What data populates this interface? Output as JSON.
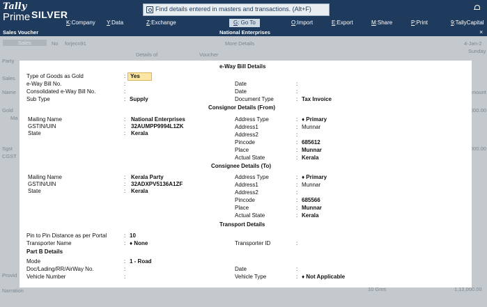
{
  "app": {
    "logo_top": "Tally",
    "logo_bottom": "Prime",
    "edition": "SILVER"
  },
  "search": {
    "placeholder": "Find details entered in masters and transactions. (Alt+F)"
  },
  "menu": [
    {
      "key": "K",
      "label": ":Company"
    },
    {
      "key": "Y",
      "label": ":Data"
    },
    {
      "key": "Z",
      "label": ":Exchange"
    },
    {
      "key": "G",
      "label": ": Go To"
    },
    {
      "key": "O",
      "label": ":Import"
    },
    {
      "key": "E",
      "label": ":Export"
    },
    {
      "key": "M",
      "label": ":Share"
    },
    {
      "key": "P",
      "label": ":Print"
    },
    {
      "key": "9",
      "label": ":TallyCapital"
    }
  ],
  "voucher_bar": {
    "title": "Sales Voucher",
    "company": "National Enterprises",
    "close": "×"
  },
  "background": {
    "type_tag": "Sales",
    "no_label": "No",
    "voucher_no": "forjecn91",
    "more_details": "More Details",
    "date": "4-Jan-2",
    "day": "Sunday",
    "party_label": "Party",
    "sales_label": "Sales",
    "name_label": "Name",
    "amount_label": "Amount",
    "item1": "Gold",
    "item1_sub": "Ma",
    "item1_amt": "000.00",
    "item2": "Sgst",
    "item2_sub": "CGST",
    "item2_amt": "000.00",
    "provided_label": "Provid",
    "narration_label": "Narration",
    "total_qty": "10 Gms",
    "total_amt": "1,12,000.00",
    "col_details_of": "Details of",
    "col_voucher": "Voucher"
  },
  "modal": {
    "title": "e-Way Bill Details",
    "type_of_goods": {
      "label": "Type of Goods as Gold",
      "value": "Yes"
    },
    "eway_bill_no": {
      "label": "e-Way Bill No.",
      "value": "",
      "date_label": "Date",
      "date_value": ""
    },
    "consolidated": {
      "label": "Consolidated e-Way Bill No.",
      "value": "",
      "date_label": "Date",
      "date_value": ""
    },
    "sub_type": {
      "label": "Sub Type",
      "value": "Supply",
      "doc_label": "Document Type",
      "doc_value": "Tax Invoice"
    },
    "consignor": {
      "heading": "Consignor Details (From)",
      "mailing_name": {
        "label": "Mailing Name",
        "value": "National Enterprises"
      },
      "gstin": {
        "label": "GSTIN/UIN",
        "value": "32AUMPP9994L1ZK"
      },
      "state": {
        "label": "State",
        "value": "Kerala"
      },
      "address_type": {
        "label": "Address Type",
        "value": "♦ Primary"
      },
      "address1": {
        "label": "Address1",
        "value": "Munnar"
      },
      "address2": {
        "label": "Address2",
        "value": ""
      },
      "pincode": {
        "label": "Pincode",
        "value": "685612"
      },
      "place": {
        "label": "Place",
        "value": "Munnar"
      },
      "actual_state": {
        "label": "Actual State",
        "value": "Kerala"
      }
    },
    "consignee": {
      "heading": "Consignee Details (To)",
      "mailing_name": {
        "label": "Mailing Name",
        "value": "Kerala Party"
      },
      "gstin": {
        "label": "GSTIN/UIN",
        "value": "32ADXPV5136A1ZF"
      },
      "state": {
        "label": "State",
        "value": "Kerala"
      },
      "address_type": {
        "label": "Address Type",
        "value": "♦ Primary"
      },
      "address1": {
        "label": "Address1",
        "value": "Munnar"
      },
      "address2": {
        "label": "Address2",
        "value": ""
      },
      "pincode": {
        "label": "Pincode",
        "value": "685566"
      },
      "place": {
        "label": "Place",
        "value": "Munnar"
      },
      "actual_state": {
        "label": "Actual State",
        "value": "Kerala"
      }
    },
    "transport": {
      "heading": "Transport Details",
      "distance": {
        "label": "Pin to Pin Distance as per Portal",
        "value": "10"
      },
      "transporter_name": {
        "label": "Transporter Name",
        "value": "♦ None"
      },
      "transporter_id": {
        "label": "Transporter ID",
        "value": ""
      }
    },
    "part_b": {
      "heading": "Part B Details",
      "mode": {
        "label": "Mode",
        "value": "1 - Road"
      },
      "doc_no": {
        "label": "Doc/Lading/RR/AirWay No.",
        "value": "",
        "date_label": "Date",
        "date_value": ""
      },
      "vehicle_number": {
        "label": "Vehicle Number",
        "value": "",
        "type_label": "Vehicle Type",
        "type_value": "♦ Not Applicable"
      }
    },
    "colon": ":"
  }
}
